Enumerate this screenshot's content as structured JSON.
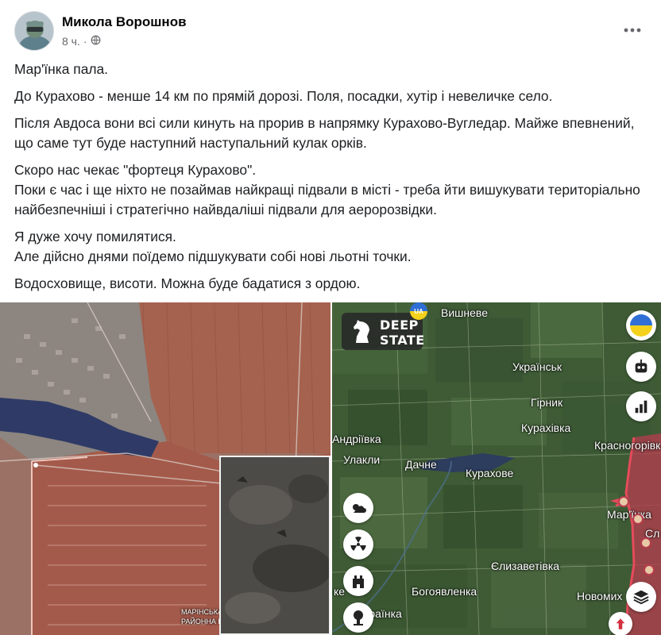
{
  "post": {
    "author": "Микола Ворошнов",
    "time": "8 ч.",
    "icons": {
      "privacy": "globe-icon",
      "more": "more-horizontal-icon"
    },
    "paragraphs": [
      "Мар'їнка пала.",
      "До Курахово - менше 14 км по прямій дорозі. Поля, посадки, хутір і невеличке село.",
      "Після Авдоса вони всі сили кинуть на прорив в напрямку Курахово-Вугледар. Майже впевнений, що саме тут буде наступний наступальний кулак орків.",
      "Скоро нас чекає \"фортеця Курахово\".",
      "Поки є час і ще ніхто не позаймав найкращі підвали в місті - треба йти вишукувати територіально найбезпечніші і стратегічно найвдаліші підвали для аеророзвідки.",
      "Я дуже хочу помилятися.",
      "Але дійсно днями поїдемо підшукувати собі нові льотні точки.",
      "Водосховище, висоти. Можна буде бадатися з ордою."
    ]
  },
  "left_map": {
    "labels": [
      "МАРІНСЬКА",
      "РАЙОННА РАДА"
    ]
  },
  "right_map": {
    "logo": {
      "line1": "DEEP",
      "line2": "STATE",
      "badge": "UA"
    },
    "places": {
      "vyshneve": "Вишневе",
      "ukrainsk": "Українськ",
      "hirnyk": "Гірник",
      "kurakhivka": "Курахівка",
      "andriivka": "Андріївка",
      "krasnohorivka": "Красногорівк",
      "ulakly": "Улакли",
      "dachne": "Дачне",
      "kurakhove": "Курахове",
      "marinka": "Мар'їнка",
      "yelyzavetivka": "Єлизаветівка",
      "bohoyavlenka": "Богоявленка",
      "novomykhailivka": "Новомих",
      "ukrainka": "Українка",
      "ke": "ке",
      "sl": "Сл"
    },
    "right_controls": [
      "ukraine-flag-icon",
      "robot-icon",
      "bar-chart-icon",
      "layers-icon",
      "arrow-up-icon"
    ],
    "left_controls": [
      "weather-icon",
      "radiation-icon",
      "tower-icon",
      "explosion-icon"
    ],
    "colors": {
      "occupied": "#b73c4f",
      "frontline": "#e54b5a",
      "water": "#2e3f6b",
      "field": "#3e5b35"
    }
  }
}
